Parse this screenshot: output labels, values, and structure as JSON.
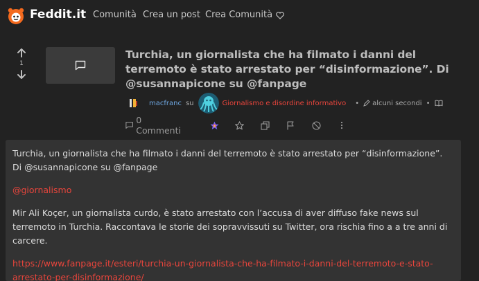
{
  "navbar": {
    "brand": "Feddit.it",
    "links": [
      "Comunità",
      "Crea un post",
      "Crea Comunità"
    ]
  },
  "post": {
    "score": "1",
    "title": "Turchia, un giornalista che ha filmato i danni del terremoto è stato arrestato per “disinformazione”. Di @susannapicone su @fanpage",
    "author": "macfranc",
    "in_label": "su",
    "community": "Giornalismo e disordine informativo",
    "time": "alcuni secondi",
    "comments_label": "0 Commenti"
  },
  "body": {
    "paragraph1": "Turchia, un giornalista che ha filmato i danni del terremoto è stato arrestato per “disinformazione”. Di @susannapicone su @fanpage",
    "mention": "@giornalismo",
    "paragraph2": "Mir Ali Koçer, un giornalista curdo, è stato arrestato con l’accusa di aver diffuso fake news sul terremoto in Turchia. Raccontava le storie dei sopravvissuti su Twitter, ora rischia fino a a tre anni di carcere.",
    "link": "https://www.fanpage.it/esteri/turchia-un-giornalista-che-ha-filmato-i-danni-del-terremoto-e-stato-arrestato-per-disinformazione/"
  },
  "colors": {
    "background": "#222222",
    "panel": "#333333",
    "link_red": "#e8453c",
    "user_blue": "#6ea6e0"
  }
}
